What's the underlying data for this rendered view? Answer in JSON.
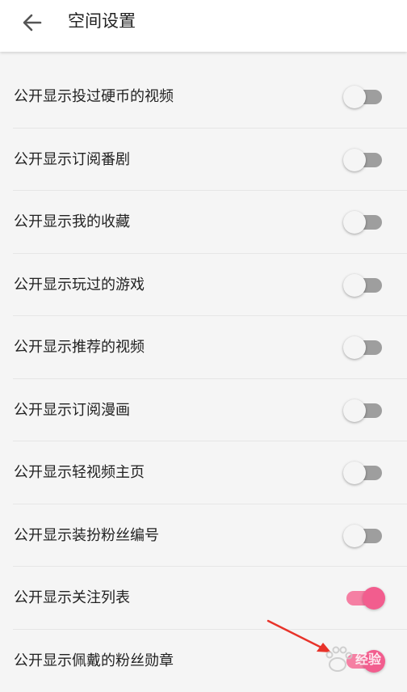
{
  "header": {
    "title": "空间设置",
    "back_icon": "arrow-left-icon"
  },
  "settings": [
    {
      "label": "公开显示投过硬币的视频",
      "enabled": false
    },
    {
      "label": "公开显示订阅番剧",
      "enabled": false
    },
    {
      "label": "公开显示我的收藏",
      "enabled": false
    },
    {
      "label": "公开显示玩过的游戏",
      "enabled": false
    },
    {
      "label": "公开显示推荐的视频",
      "enabled": false
    },
    {
      "label": "公开显示订阅漫画",
      "enabled": false
    },
    {
      "label": "公开显示轻视频主页",
      "enabled": false
    },
    {
      "label": "公开显示装扮粉丝编号",
      "enabled": false
    },
    {
      "label": "公开显示关注列表",
      "enabled": true
    },
    {
      "label": "公开显示佩戴的粉丝勋章",
      "enabled": true
    }
  ],
  "colors": {
    "accent": "#f25d8e",
    "accent_track": "#f57fa3",
    "off_track": "#9e9e9e",
    "annotation_arrow": "#e8332a"
  },
  "watermark": {
    "text": "经验"
  }
}
